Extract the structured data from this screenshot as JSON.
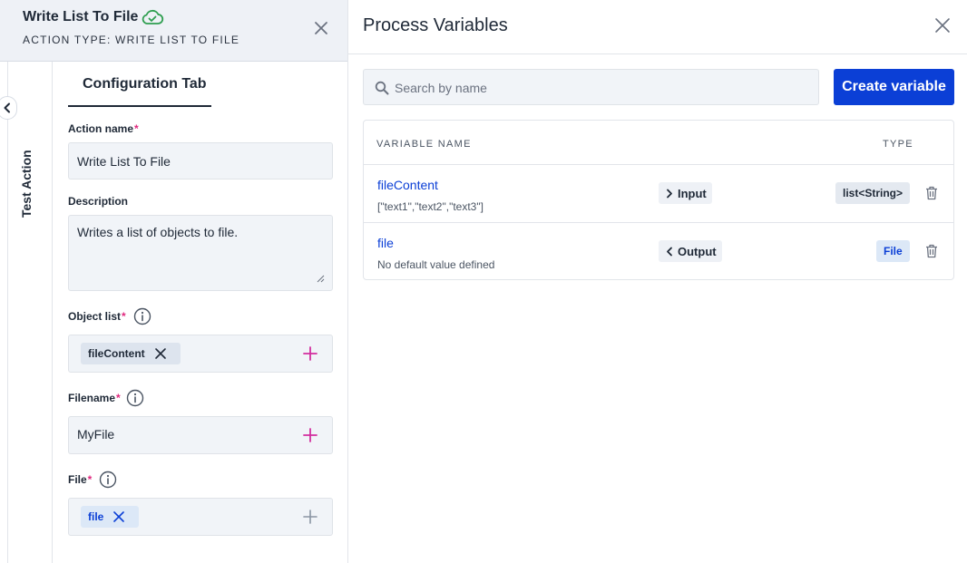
{
  "action_panel": {
    "title": "Write List To File",
    "subtitle": "ACTION TYPE: WRITE LIST TO FILE",
    "side_tab_label": "Test Action",
    "config_tab_label": "Configuration Tab",
    "fields": {
      "action_name": {
        "label": "Action name",
        "required_mark": "*",
        "value": "Write List To File"
      },
      "description": {
        "label": "Description",
        "value": "Writes a list of objects to file."
      },
      "object_list": {
        "label": "Object list",
        "required_mark": "*",
        "chip": "fileContent"
      },
      "filename": {
        "label": "Filename",
        "required_mark": "*",
        "value": "MyFile"
      },
      "file": {
        "label": "File",
        "required_mark": "*",
        "chip": "file"
      }
    }
  },
  "process_variables": {
    "title": "Process Variables",
    "search_placeholder": "Search by name",
    "create_button": "Create variable",
    "columns": {
      "name": "VARIABLE NAME",
      "type": "TYPE"
    },
    "rows": [
      {
        "name": "fileContent",
        "default": "[\"text1\",\"text2\",\"text3\"]",
        "direction": "Input",
        "type": "list<String>"
      },
      {
        "name": "file",
        "default": "No default value defined",
        "direction": "Output",
        "type": "File"
      }
    ]
  },
  "colors": {
    "accent_blue": "#0b3fd6",
    "required_pink": "#e0287e",
    "success_green": "#2e9e4f",
    "panel_bg": "#eef1f6"
  },
  "icons": [
    "cloud-check-icon",
    "close-icon",
    "chevron-left-icon",
    "info-icon",
    "plus-icon",
    "search-icon",
    "chevron-right-icon",
    "trash-icon"
  ]
}
